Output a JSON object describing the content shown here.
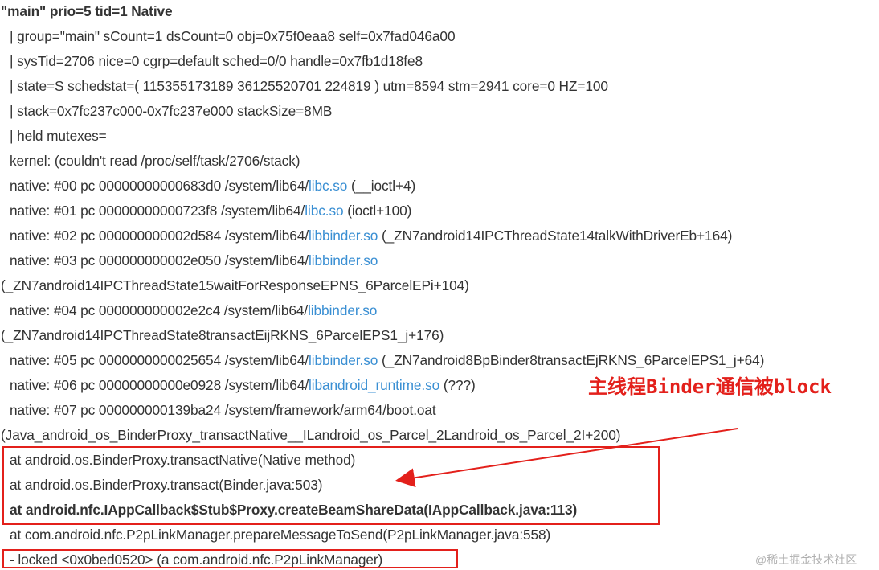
{
  "thread_header": "\"main\" prio=5 tid=1 Native",
  "info": [
    " | group=\"main\" sCount=1 dsCount=0 obj=0x75f0eaa8 self=0x7fad046a00",
    " | sysTid=2706 nice=0 cgrp=default sched=0/0 handle=0x7fb1d18fe8",
    " | state=S schedstat=( 115355173189 36125520701 224819 ) utm=8594 stm=2941 core=0 HZ=100",
    " | stack=0x7fc237c000-0x7fc237e000 stackSize=8MB",
    " | held mutexes=",
    "kernel: (couldn't read /proc/self/task/2706/stack)"
  ],
  "frames": [
    {
      "prefix": "native: #00 pc 00000000000683d0  /system/lib64/",
      "lib": "libc.so",
      "suffix": " (__ioctl+4)"
    },
    {
      "prefix": "native: #01 pc 00000000000723f8  /system/lib64/",
      "lib": "libc.so",
      "suffix": " (ioctl+100)"
    },
    {
      "prefix": "native: #02 pc 000000000002d584  /system/lib64/",
      "lib": "libbinder.so",
      "suffix": " (_ZN7android14IPCThreadState14talkWithDriverEb+164)"
    },
    {
      "prefix": "native: #03 pc 000000000002e050  /system/lib64/",
      "lib": "libbinder.so",
      "suffix": ""
    },
    {
      "continuation": "(_ZN7android14IPCThreadState15waitForResponseEPNS_6ParcelEPi+104)"
    },
    {
      "prefix": "native: #04 pc 000000000002e2c4  /system/lib64/",
      "lib": "libbinder.so",
      "suffix": ""
    },
    {
      "continuation": "(_ZN7android14IPCThreadState8transactEijRKNS_6ParcelEPS1_j+176)"
    },
    {
      "prefix": "native: #05 pc 0000000000025654  /system/lib64/",
      "lib": "libbinder.so",
      "suffix": " (_ZN7android8BpBinder8transactEjRKNS_6ParcelEPS1_j+64)"
    },
    {
      "prefix": "native: #06 pc 00000000000e0928  /system/lib64/",
      "lib": "libandroid_runtime.so",
      "suffix": " (???)"
    },
    {
      "prefix": "native: #07 pc 000000000139ba24  /system/framework/arm64/boot.oat",
      "lib": "",
      "suffix": ""
    },
    {
      "continuation": "(Java_android_os_BinderProxy_transactNative__ILandroid_os_Parcel_2Landroid_os_Parcel_2I+200)"
    }
  ],
  "java_frames": [
    "at android.os.BinderProxy.transactNative(Native method)",
    "at android.os.BinderProxy.transact(Binder.java:503)",
    "at android.nfc.IAppCallback$Stub$Proxy.createBeamShareData(IAppCallback.java:113)",
    "at com.android.nfc.P2pLinkManager.prepareMessageToSend(P2pLinkManager.java:558)",
    "- locked <0x0bed0520> (a com.android.nfc.P2pLinkManager)"
  ],
  "annotation": "主线程Binder通信被block",
  "watermark": "@稀土掘金技术社区",
  "colors": {
    "link": "#3a8fd3",
    "highlight": "#e3201b",
    "text": "#333333"
  }
}
